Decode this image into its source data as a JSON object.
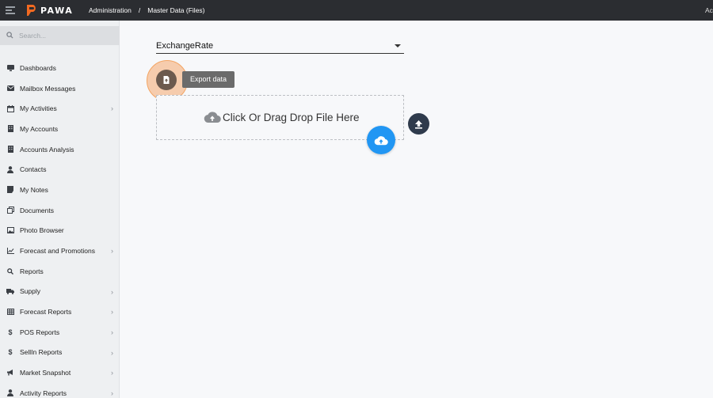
{
  "topbar": {
    "logo_text": "PAWA",
    "breadcrumbs": [
      "Administration",
      "Master Data (Files)"
    ],
    "breadcrumb_separator": "/",
    "right_text": "Ac"
  },
  "sidebar": {
    "search_placeholder": "Search...",
    "items": [
      {
        "label": "Dashboards",
        "icon": "dashboard-icon",
        "chevron": false
      },
      {
        "label": "Mailbox Messages",
        "icon": "envelope-icon",
        "chevron": false
      },
      {
        "label": "My Activities",
        "icon": "calendar-icon",
        "chevron": true
      },
      {
        "label": "My Accounts",
        "icon": "building-icon",
        "chevron": false
      },
      {
        "label": "Accounts Analysis",
        "icon": "building-icon",
        "chevron": false
      },
      {
        "label": "Contacts",
        "icon": "person-icon",
        "chevron": false
      },
      {
        "label": "My Notes",
        "icon": "note-icon",
        "chevron": false
      },
      {
        "label": "Documents",
        "icon": "documents-icon",
        "chevron": false
      },
      {
        "label": "Photo Browser",
        "icon": "image-icon",
        "chevron": false
      },
      {
        "label": "Forecast and Promotions",
        "icon": "line-chart-icon",
        "chevron": true
      },
      {
        "label": "Reports",
        "icon": "search-icon",
        "chevron": false
      },
      {
        "label": "Supply",
        "icon": "truck-icon",
        "chevron": true
      },
      {
        "label": "Forecast Reports",
        "icon": "table-icon",
        "chevron": true
      },
      {
        "label": "POS Reports",
        "icon": "dollar-icon",
        "chevron": true
      },
      {
        "label": "SellIn Reports",
        "icon": "dollar-icon",
        "chevron": true
      },
      {
        "label": "Market Snapshot",
        "icon": "megaphone-icon",
        "chevron": true
      },
      {
        "label": "Activity Reports",
        "icon": "person-icon",
        "chevron": true
      }
    ],
    "chevron_glyph": "›"
  },
  "main": {
    "select_value": "ExchangeRate",
    "export_tooltip": "Export data",
    "dropzone_text": "Click Or Drag Drop File Here"
  },
  "colors": {
    "topbar": "#2b2d31",
    "accent_orange": "#f3a462",
    "upload_blue": "#2196f3",
    "upload_dark": "#2f3b4c"
  }
}
